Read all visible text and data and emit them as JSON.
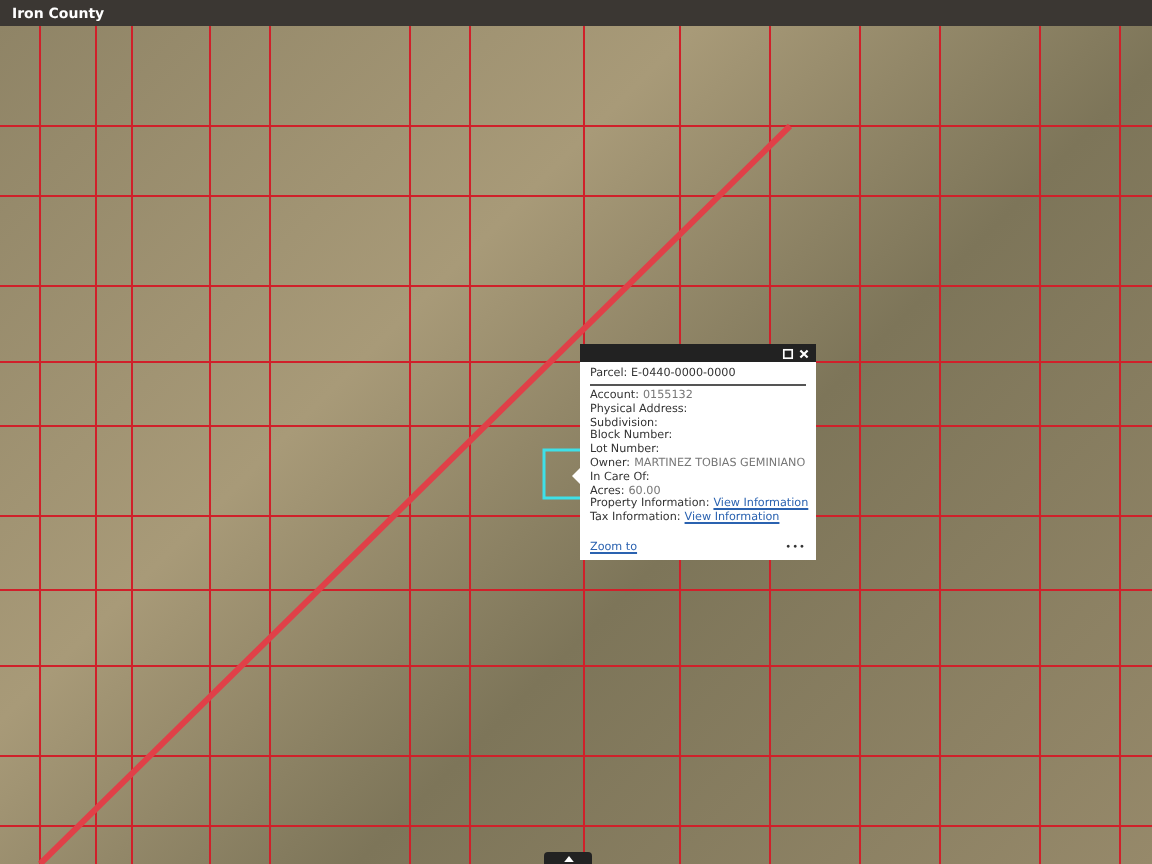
{
  "header": {
    "title": "Iron County"
  },
  "popup": {
    "title": "Parcel: E-0440-0000-0000",
    "rows": [
      {
        "label": "Account:",
        "value": "0155132",
        "kind": "text"
      },
      {
        "label": "Physical Address:"
      },
      {
        "label": "Subdivision:"
      },
      {
        "label": "Block Number:"
      },
      {
        "label": "Lot Number:"
      },
      {
        "label": "Owner:",
        "value": "MARTINEZ TOBIAS GEMINIANO",
        "kind": "text"
      },
      {
        "label": "In Care Of:"
      },
      {
        "label": "Acres:",
        "value": "60.00",
        "kind": "text"
      },
      {
        "label": "Property Information:",
        "value": "View Information",
        "kind": "link"
      },
      {
        "label": "Tax Information:",
        "value": "View Information",
        "kind": "link"
      }
    ],
    "zoom_link": "Zoom to",
    "more": "•••"
  }
}
